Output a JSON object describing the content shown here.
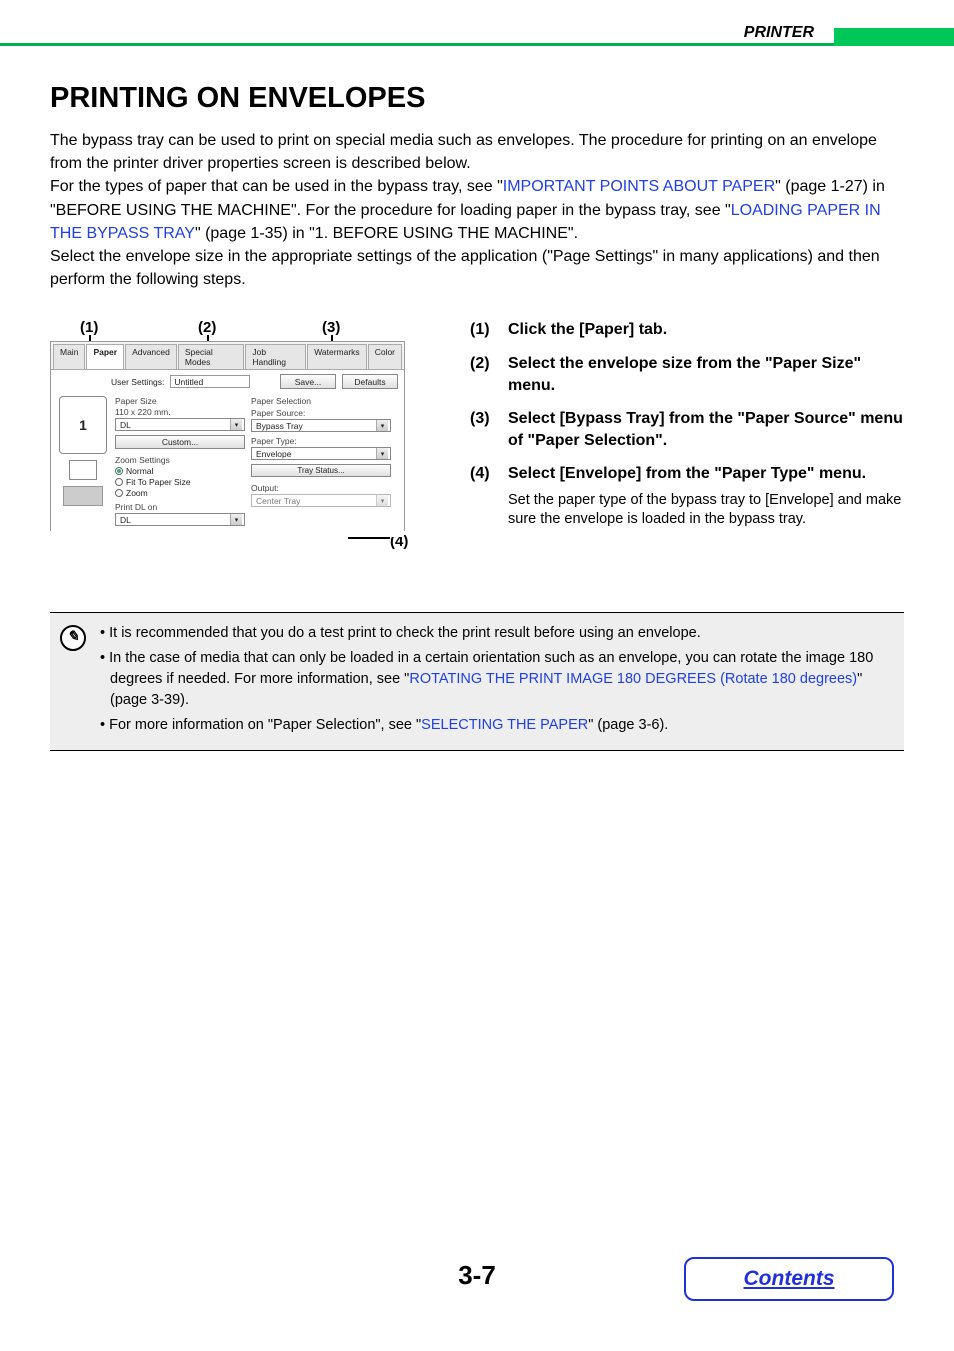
{
  "header": {
    "section": "PRINTER"
  },
  "title": "PRINTING ON ENVELOPES",
  "intro": {
    "p1": "The bypass tray can be used to print on special media such as envelopes. The procedure for printing on an envelope from the printer driver properties screen is described below.",
    "p2a": "For the types of paper that can be used in the bypass tray, see \"",
    "link1": "IMPORTANT POINTS ABOUT PAPER",
    "p2b": "\" (page 1-27) in \"BEFORE USING THE MACHINE\". For the procedure for loading paper in the bypass tray, see \"",
    "link2": "LOADING PAPER IN THE BYPASS TRAY",
    "p2c": "\" (page 1-35) in \"1. BEFORE USING THE MACHINE\".",
    "p3": "Select the envelope size in the appropriate settings of the application (\"Page Settings\" in many applications) and then perform the following steps."
  },
  "callouts": {
    "c1": "(1)",
    "c2": "(2)",
    "c3": "(3)",
    "c4": "(4)"
  },
  "dialog": {
    "tabs": [
      "Main",
      "Paper",
      "Advanced",
      "Special Modes",
      "Job Handling",
      "Watermarks",
      "Color"
    ],
    "activeTab": "Paper",
    "userSettingsLabel": "User Settings:",
    "userSettingsValue": "Untitled",
    "saveBtn": "Save...",
    "defaultsBtn": "Defaults",
    "previewNum": "1",
    "paperSizeLabel": "Paper Size",
    "paperSizeDim": "110 x 220 mm.",
    "paperSizeValue": "DL",
    "customBtn": "Custom...",
    "zoomLabel": "Zoom Settings",
    "zoomNormal": "Normal",
    "zoomFit": "Fit To Paper Size",
    "zoomZoom": "Zoom",
    "printDLLabel": "Print DL on",
    "printDLValue": "DL",
    "paperSelLabel": "Paper Selection",
    "paperSourceLabel": "Paper Source:",
    "paperSourceValue": "Bypass Tray",
    "paperTypeLabel": "Paper Type:",
    "paperTypeValue": "Envelope",
    "trayStatusBtn": "Tray Status...",
    "outputLabel": "Output:",
    "outputValue": "Center Tray"
  },
  "steps": {
    "s1n": "(1)",
    "s1": "Click the [Paper] tab.",
    "s2n": "(2)",
    "s2": "Select the envelope size from the \"Paper Size\" menu.",
    "s3n": "(3)",
    "s3": "Select [Bypass Tray] from the \"Paper Source\" menu of \"Paper Selection\".",
    "s4n": "(4)",
    "s4": "Select [Envelope] from the \"Paper Type\" menu.",
    "s4note": "Set the paper type of the bypass tray to [Envelope] and make sure the envelope is loaded in the bypass tray."
  },
  "notes": {
    "n1": "It is recommended that you do a test print to check the print result before using an envelope.",
    "n2a": "In the case of media that can only be loaded in a certain orientation such as an envelope, you can rotate the image 180 degrees if needed. For more information, see \"",
    "n2link": "ROTATING THE PRINT IMAGE 180 DEGREES (Rotate 180 degrees)",
    "n2b": "\" (page 3-39).",
    "n3a": "For more information on \"Paper Selection\", see \"",
    "n3link": "SELECTING THE PAPER",
    "n3b": "\" (page 3-6)."
  },
  "pageNumber": "3-7",
  "contentsLabel": "Contents"
}
